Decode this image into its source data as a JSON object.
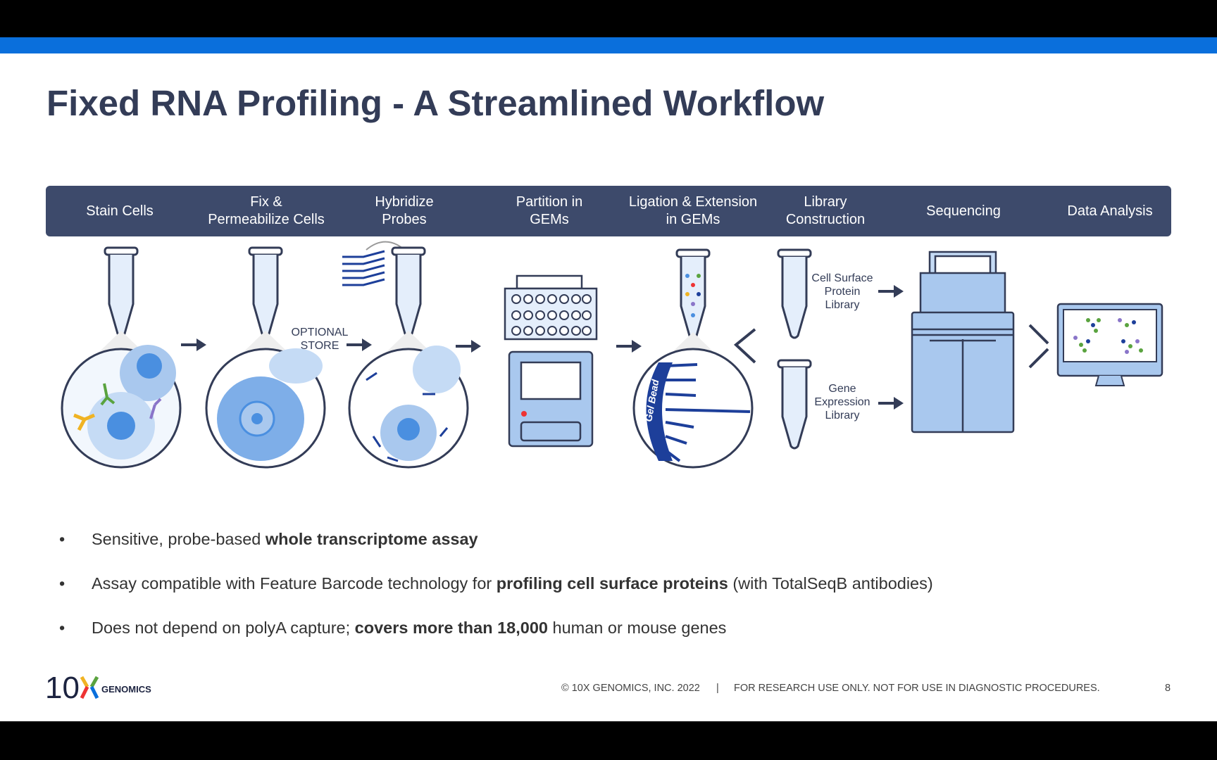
{
  "title": "Fixed RNA Profiling - A Streamlined Workflow",
  "steps": [
    "Stain Cells",
    "Fix &\nPermeabilize Cells",
    "Hybridize\nProbes",
    "Partition in\nGEMs",
    "Ligation & Extension\nin GEMs",
    "Library\nConstruction",
    "Sequencing",
    "Data Analysis"
  ],
  "labels": {
    "optional_store": "OPTIONAL\nSTORE",
    "gel_bead": "Gel Bead",
    "cell_surface": "Cell Surface\nProtein\nLibrary",
    "gene_expression": "Gene\nExpression\nLibrary"
  },
  "bullets": [
    {
      "pre": "Sensitive, probe-based ",
      "bold": "whole transcriptome assay",
      "post": ""
    },
    {
      "pre": "Assay compatible with Feature Barcode technology for ",
      "bold": "profiling cell surface proteins",
      "post": " (with TotalSeqB antibodies)"
    },
    {
      "pre": "Does not depend on polyA capture; ",
      "bold": "covers more than 18,000",
      "post": " human or mouse genes"
    }
  ],
  "footer": {
    "copyright": "© 10X GENOMICS, INC. 2022",
    "separator": "|",
    "disclaimer": "FOR RESEARCH USE ONLY. NOT FOR USE IN DIAGNOSTIC PROCEDURES.",
    "page": "8"
  },
  "logo": {
    "text": "10X GENOMICS"
  },
  "colors": {
    "accent": "#0a6fdc",
    "band": "#3d4a6b",
    "title": "#333c57",
    "illustration": "#a9c8ee"
  }
}
